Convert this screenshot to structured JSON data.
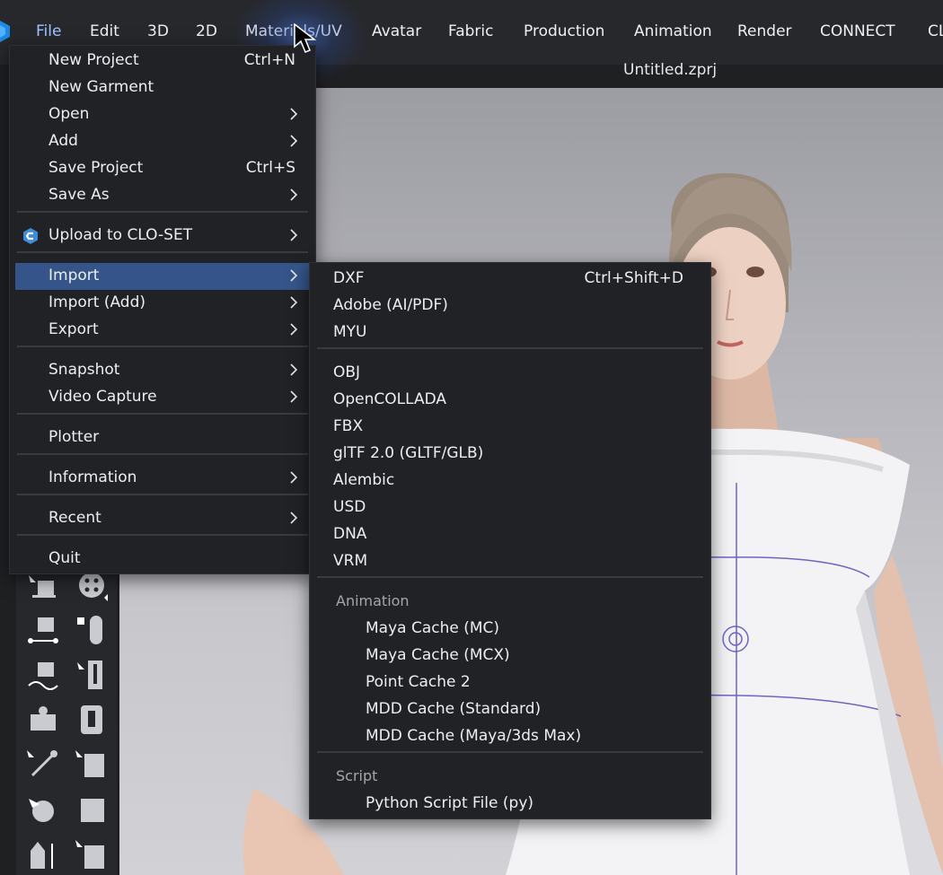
{
  "menubar": {
    "items": [
      "File",
      "Edit",
      "3D",
      "2D",
      "Materials/UV",
      "Avatar",
      "Fabric",
      "Production",
      "Animation",
      "Render",
      "CONNECT",
      "CL"
    ]
  },
  "document": {
    "title": "Untitled.zprj"
  },
  "file_menu": {
    "items": [
      {
        "label": "New Project",
        "shortcut": "Ctrl+N"
      },
      {
        "label": "New Garment"
      },
      {
        "label": "Open",
        "submenu": true
      },
      {
        "label": "Add",
        "submenu": true
      },
      {
        "label": "Save Project",
        "shortcut": "Ctrl+S"
      },
      {
        "label": "Save As",
        "submenu": true
      },
      {
        "label": "Upload to CLO-SET",
        "submenu": true
      },
      {
        "label": "Import",
        "submenu": true,
        "highlighted": true
      },
      {
        "label": "Import (Add)",
        "submenu": true
      },
      {
        "label": "Export",
        "submenu": true
      },
      {
        "label": "Snapshot",
        "submenu": true
      },
      {
        "label": "Video Capture",
        "submenu": true
      },
      {
        "label": "Plotter"
      },
      {
        "label": "Information",
        "submenu": true
      },
      {
        "label": "Recent",
        "submenu": true
      },
      {
        "label": "Quit"
      }
    ]
  },
  "import_menu": {
    "items": [
      {
        "label": "DXF",
        "shortcut": "Ctrl+Shift+D"
      },
      {
        "label": "Adobe (AI/PDF)"
      },
      {
        "label": "MYU"
      },
      {
        "label": "OBJ"
      },
      {
        "label": "OpenCOLLADA"
      },
      {
        "label": "FBX"
      },
      {
        "label": "glTF 2.0 (GLTF/GLB)"
      },
      {
        "label": "Alembic"
      },
      {
        "label": "USD"
      },
      {
        "label": "DNA"
      },
      {
        "label": "VRM"
      }
    ],
    "animation_header": "Animation",
    "animation_items": [
      {
        "label": "Maya Cache (MC)"
      },
      {
        "label": "Maya Cache (MCX)"
      },
      {
        "label": "Point Cache 2"
      },
      {
        "label": "MDD Cache (Standard)"
      },
      {
        "label": "MDD Cache (Maya/3ds Max)"
      }
    ],
    "script_header": "Script",
    "script_items": [
      {
        "label": "Python Script File (py)"
      }
    ]
  },
  "colors": {
    "menu_bg": "#212226",
    "highlight": "#35558a",
    "active_menu_text": "#9fc3ff",
    "separator": "#3a3b41"
  },
  "icons": {
    "app_logo": "clo-logo-icon",
    "clo_set": "clo-set-icon",
    "submenu": "chevron-right-icon"
  }
}
